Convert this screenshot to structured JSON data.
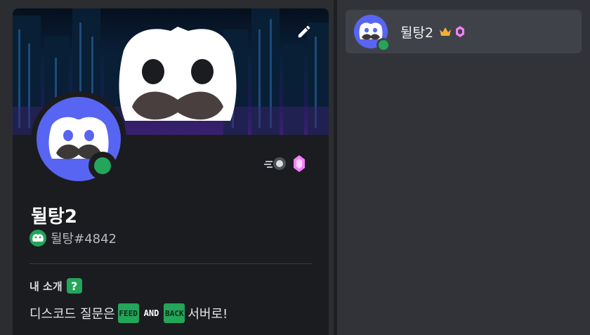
{
  "profile": {
    "display_name": "뒬탕2",
    "username": "뒬탕#4842",
    "about_title": "내 소개",
    "about_title_emoji": "?",
    "bio_prefix": "디스코드 질문은",
    "bio_suffix": "서버로!",
    "bio_emotes": [
      {
        "name": "feed-emote",
        "text": "FEED"
      },
      {
        "name": "and-emote",
        "text": "AND"
      },
      {
        "name": "back-emote",
        "text": "BACK"
      }
    ],
    "status": "online",
    "badges": [
      "speed-boost-badge",
      "nitro-gem-badge"
    ],
    "edit_icon": "pencil-icon"
  },
  "member_list": {
    "item": {
      "name": "뒬탕2",
      "status": "online",
      "icons": [
        "crown-icon",
        "nitro-gem-icon"
      ]
    }
  },
  "colors": {
    "accent": "#5865f2",
    "online": "#23a55a",
    "gem": "#f47fff",
    "crown": "#f0b232"
  }
}
